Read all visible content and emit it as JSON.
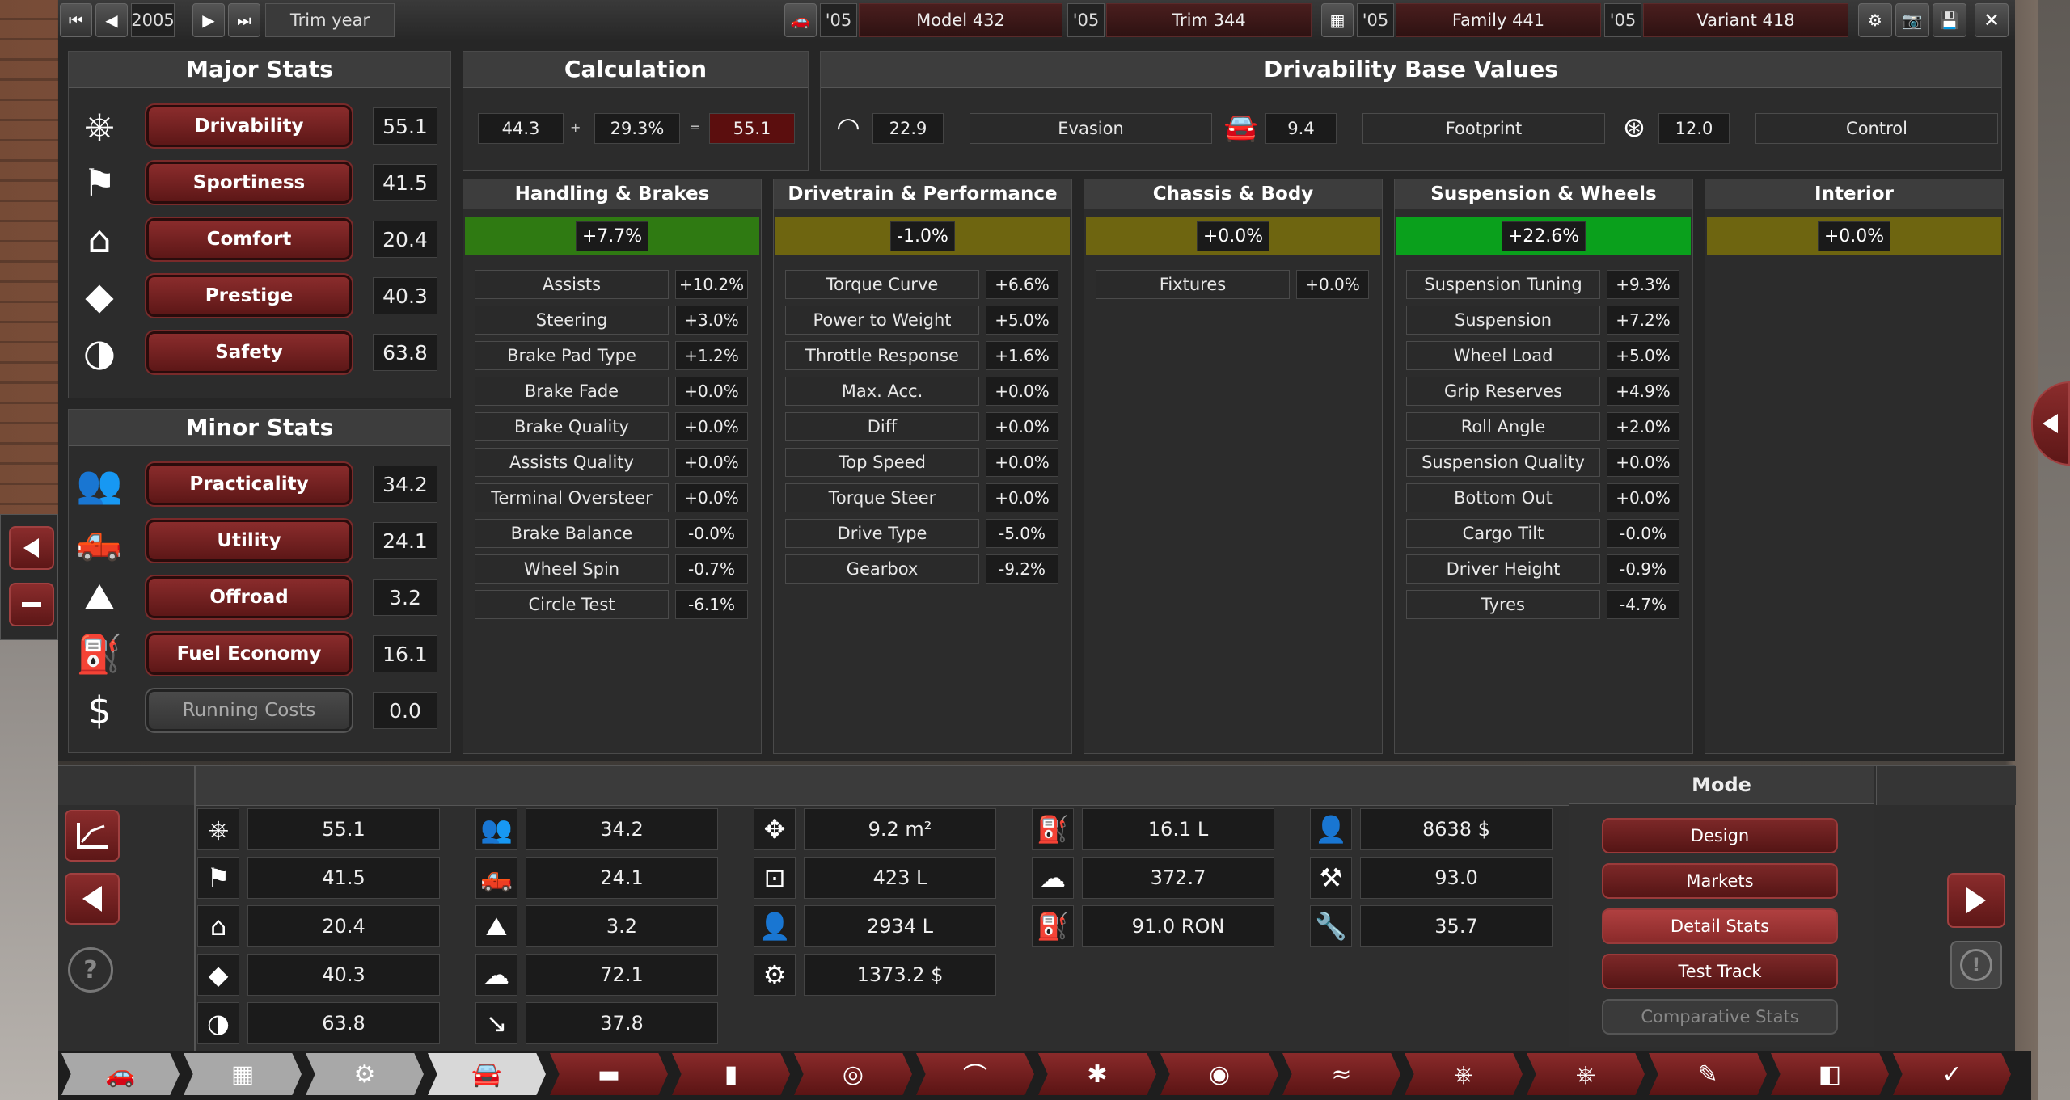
{
  "topbar": {
    "year": "2005",
    "trim_year_label": "Trim year",
    "model_year": "'05",
    "model": "Model 432",
    "trim_year": "'05",
    "trim": "Trim 344",
    "family_year": "'05",
    "family": "Family 441",
    "variant_year": "'05",
    "variant": "Variant 418"
  },
  "major_stats": {
    "title": "Major Stats",
    "items": [
      {
        "icon": "steering-wheel-icon",
        "label": "Drivability",
        "value": "55.1"
      },
      {
        "icon": "checkered-flag-icon",
        "label": "Sportiness",
        "value": "41.5"
      },
      {
        "icon": "armchair-icon",
        "label": "Comfort",
        "value": "20.4"
      },
      {
        "icon": "diamond-icon",
        "label": "Prestige",
        "value": "40.3"
      },
      {
        "icon": "crash-test-icon",
        "label": "Safety",
        "value": "63.8"
      }
    ]
  },
  "minor_stats": {
    "title": "Minor Stats",
    "items": [
      {
        "icon": "people-icon",
        "label": "Practicality",
        "value": "34.2",
        "disabled": false
      },
      {
        "icon": "pickup-truck-icon",
        "label": "Utility",
        "value": "24.1",
        "disabled": false
      },
      {
        "icon": "offroad-icon",
        "label": "Offroad",
        "value": "3.2",
        "disabled": false
      },
      {
        "icon": "fuel-can-icon",
        "label": "Fuel Economy",
        "value": "16.1",
        "disabled": false
      },
      {
        "icon": "dollar-icon",
        "label": "Running Costs",
        "value": "0.0",
        "disabled": true
      }
    ]
  },
  "calculation": {
    "title": "Calculation",
    "base": "44.3",
    "plus": "+",
    "percent": "29.3%",
    "equals": "=",
    "result": "55.1"
  },
  "base_values": {
    "title": "Drivability Base Values",
    "items": [
      {
        "icon": "gauge-icon",
        "value": "22.9",
        "label": "Evasion"
      },
      {
        "icon": "car-front-icon",
        "value": "9.4",
        "label": "Footprint"
      },
      {
        "icon": "wheel-control-icon",
        "value": "12.0",
        "label": "Control"
      }
    ]
  },
  "categories": [
    {
      "title": "Handling & Brakes",
      "total": "+7.7%",
      "color": "#2f7a12",
      "items": [
        [
          "Assists",
          "+10.2%"
        ],
        [
          "Steering",
          "+3.0%"
        ],
        [
          "Brake Pad Type",
          "+1.2%"
        ],
        [
          "Brake Fade",
          "+0.0%"
        ],
        [
          "Brake Quality",
          "+0.0%"
        ],
        [
          "Assists Quality",
          "+0.0%"
        ],
        [
          "Terminal Oversteer",
          "+0.0%"
        ],
        [
          "Brake Balance",
          "-0.0%"
        ],
        [
          "Wheel Spin",
          "-0.7%"
        ],
        [
          "Circle Test",
          "-6.1%"
        ]
      ]
    },
    {
      "title": "Drivetrain & Performance",
      "total": "-1.0%",
      "color": "#6e6510",
      "items": [
        [
          "Torque Curve",
          "+6.6%"
        ],
        [
          "Power to Weight",
          "+5.0%"
        ],
        [
          "Throttle Response",
          "+1.6%"
        ],
        [
          "Max. Acc.",
          "+0.0%"
        ],
        [
          "Diff",
          "+0.0%"
        ],
        [
          "Top Speed",
          "+0.0%"
        ],
        [
          "Torque Steer",
          "+0.0%"
        ],
        [
          "Drive Type",
          "-5.0%"
        ],
        [
          "Gearbox",
          "-9.2%"
        ]
      ]
    },
    {
      "title": "Chassis & Body",
      "total": "+0.0%",
      "color": "#6e6510",
      "items": [
        [
          "Fixtures",
          "+0.0%"
        ]
      ]
    },
    {
      "title": "Suspension & Wheels",
      "total": "+22.6%",
      "color": "#0aa01c",
      "items": [
        [
          "Suspension Tuning",
          "+9.3%"
        ],
        [
          "Suspension",
          "+7.2%"
        ],
        [
          "Wheel Load",
          "+5.0%"
        ],
        [
          "Grip Reserves",
          "+4.9%"
        ],
        [
          "Roll Angle",
          "+2.0%"
        ],
        [
          "Suspension Quality",
          "+0.0%"
        ],
        [
          "Bottom Out",
          "+0.0%"
        ],
        [
          "Cargo Tilt",
          "-0.0%"
        ],
        [
          "Driver Height",
          "-0.9%"
        ],
        [
          "Tyres",
          "-4.7%"
        ]
      ]
    },
    {
      "title": "Interior",
      "total": "+0.0%",
      "color": "#6e6510",
      "items": []
    }
  ],
  "summary": {
    "columns": [
      [
        [
          "steering-wheel-icon",
          "55.1"
        ],
        [
          "checkered-flag-icon",
          "41.5"
        ],
        [
          "armchair-icon",
          "20.4"
        ],
        [
          "diamond-icon",
          "40.3"
        ],
        [
          "crash-test-icon",
          "63.8"
        ]
      ],
      [
        [
          "people-icon",
          "34.2"
        ],
        [
          "pickup-truck-icon",
          "24.1"
        ],
        [
          "offroad-icon",
          "3.2"
        ],
        [
          "emissions-cloud-icon",
          "72.1"
        ],
        [
          "downtrend-icon",
          "37.8"
        ]
      ],
      [
        [
          "dimensions-icon",
          "9.2 m²"
        ],
        [
          "cargo-box-icon",
          "423 L"
        ],
        [
          "passenger-volume-icon",
          "2934 L"
        ],
        [
          "service-cost-icon",
          "1373.2 $"
        ]
      ],
      [
        [
          "fuel-tank-icon",
          "16.1 L"
        ],
        [
          "emissions-icon",
          "372.7"
        ],
        [
          "fuel-pump-icon",
          "91.0 RON"
        ]
      ],
      [
        [
          "dealer-cost-icon",
          "8638 $"
        ],
        [
          "anvil-icon",
          "93.0"
        ],
        [
          "tools-icon",
          "35.7"
        ]
      ]
    ]
  },
  "mode": {
    "title": "Mode",
    "buttons": [
      {
        "label": "Design",
        "active": false,
        "disabled": false
      },
      {
        "label": "Markets",
        "active": false,
        "disabled": false
      },
      {
        "label": "Detail Stats",
        "active": true,
        "disabled": false
      },
      {
        "label": "Test Track",
        "active": false,
        "disabled": false
      },
      {
        "label": "Comparative Stats",
        "active": false,
        "disabled": true
      }
    ]
  },
  "tabs": [
    "car-body-tab",
    "engine-tab",
    "chassis-tab",
    "body-tab",
    "interior-tab",
    "fixtures-tab",
    "headlights-tab",
    "gearbox-tab",
    "wheels-tab",
    "brakes-tab",
    "aero-tab",
    "steering-tab",
    "tuning-tab",
    "paint-tab",
    "testing-tab",
    "finish-tab"
  ]
}
